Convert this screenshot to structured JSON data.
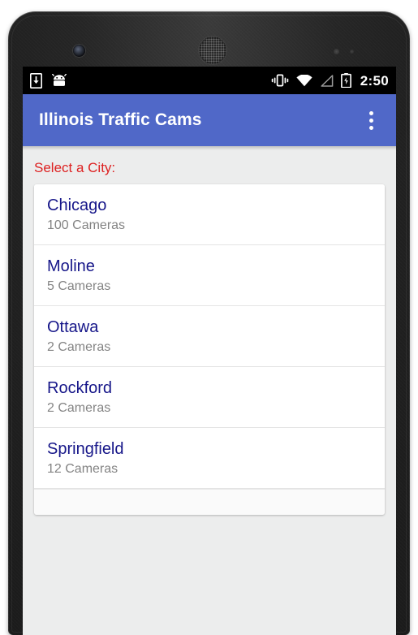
{
  "device": {
    "hardware": {
      "front_camera": "front-camera",
      "earpiece": "earpiece-speaker",
      "sensors": "proximity-sensors"
    }
  },
  "status_bar": {
    "left_icons": [
      {
        "name": "download-icon",
        "label": "download"
      },
      {
        "name": "android-robot-icon",
        "label": "android"
      }
    ],
    "right_icons": [
      {
        "name": "vibrate-icon",
        "label": "vibrate"
      },
      {
        "name": "wifi-icon",
        "label": "wifi"
      },
      {
        "name": "cell-signal-icon",
        "label": "signal"
      },
      {
        "name": "battery-charging-icon",
        "label": "battery charging"
      }
    ],
    "clock": "2:50"
  },
  "app_bar": {
    "title": "Illinois Traffic Cams",
    "overflow_menu": "overflow-menu",
    "background_color": "#5068c8",
    "title_color": "#ffffff"
  },
  "content": {
    "section_label": "Select a City:",
    "section_label_color": "#dd2222",
    "city_name_color": "#161689",
    "camera_count_color": "#848484",
    "cities": [
      {
        "name": "Chicago",
        "cameras": "100 Cameras"
      },
      {
        "name": "Moline",
        "cameras": "5 Cameras"
      },
      {
        "name": "Ottawa",
        "cameras": "2 Cameras"
      },
      {
        "name": "Rockford",
        "cameras": "2 Cameras"
      },
      {
        "name": "Springfield",
        "cameras": "12 Cameras"
      }
    ]
  }
}
